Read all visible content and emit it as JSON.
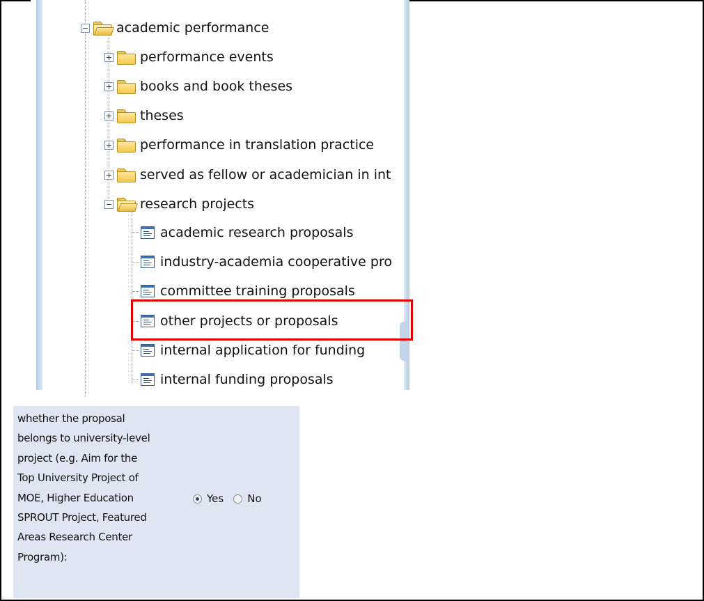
{
  "tree": {
    "root": {
      "label": "academic performance",
      "expanded": true
    },
    "folders": [
      {
        "label": "performance events"
      },
      {
        "label": "books and book theses"
      },
      {
        "label": "theses"
      },
      {
        "label": "performance in translation practice"
      },
      {
        "label": "served as fellow or academician in int"
      },
      {
        "label": "research projects",
        "expanded": true
      }
    ],
    "items": [
      {
        "label": "academic research proposals"
      },
      {
        "label": "industry-academia cooperative pro"
      },
      {
        "label": "committee training proposals"
      },
      {
        "label": "other projects or proposals",
        "highlighted": true
      },
      {
        "label": "internal application for funding"
      },
      {
        "label": "internal funding proposals"
      }
    ]
  },
  "form": {
    "question_lines": [
      "whether the proposal",
      "belongs to university-level",
      "project (e.g. Aim for the",
      "Top University Project of",
      "MOE, Higher Education",
      "SPROUT Project, Featured",
      "Areas Research Center",
      "Program):"
    ],
    "options": [
      {
        "label": "Yes",
        "selected": true
      },
      {
        "label": "No",
        "selected": false
      }
    ]
  },
  "colors": {
    "highlight_border": "#e00000",
    "form_background": "#dde6f2",
    "frame_border": "#000000"
  }
}
